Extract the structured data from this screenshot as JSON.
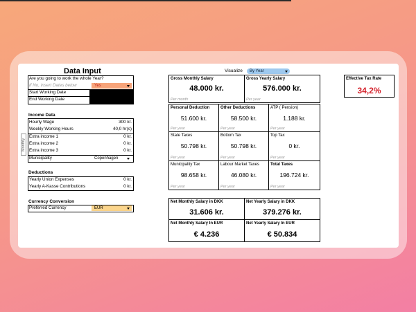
{
  "data_input": {
    "title": "Data Input",
    "question": "Are you going to work the whole Year?",
    "if_no_label": "If No, insert Dates below",
    "if_no_value": "Yes",
    "start_label": "Start Working Date",
    "end_label": "End Working Date"
  },
  "income": {
    "title": "Income Data",
    "side_label": "Monthly",
    "rows": [
      {
        "label": "Hourly Wage",
        "value": "300 kr."
      },
      {
        "label": "Weekly Working Hours",
        "value": "40,0 hr(s)"
      },
      {
        "label": "Extra income 1",
        "value": "0 kr."
      },
      {
        "label": "Extra income 2",
        "value": "0 kr."
      },
      {
        "label": "Extra income 3",
        "value": "0 kr."
      }
    ],
    "municipality_label": "Municipality",
    "municipality_value": "Copenhagen"
  },
  "deductions": {
    "title": "Deductions",
    "rows": [
      {
        "label": "Yearly Union Expenses",
        "value": "0 kr."
      },
      {
        "label": "Yearly A-Kasse Contributions",
        "value": "0 kr."
      }
    ]
  },
  "currency": {
    "title": "Currency Conversion",
    "label": "Preferred Currency",
    "value": "EUR"
  },
  "visualize": {
    "label": "Visualize",
    "value": "By Year"
  },
  "gross": {
    "monthly_label": "Gross Monthly Salary",
    "monthly_value": "48.000 kr.",
    "monthly_note": "Per month",
    "yearly_label": "Gross Yearly Salary",
    "yearly_value": "576.000 kr.",
    "yearly_note": "Per year"
  },
  "deduction_grid": [
    {
      "label": "Personal Deduction",
      "value": "51.600 kr.",
      "note": "Per year",
      "bold": true
    },
    {
      "label": "Other Deductions",
      "value": "58.500 kr.",
      "note": "Per year",
      "bold": true
    },
    {
      "label": "ATP ( Pension)",
      "value": "1.188 kr.",
      "note": "Per year",
      "bold": false
    },
    {
      "label": "State Taxes",
      "value": "50.798 kr.",
      "note": "Per year",
      "bold": false
    },
    {
      "label": "Bottom Tax",
      "value": "50.798 kr.",
      "note": "Per year",
      "bold": false
    },
    {
      "label": "Top Tax",
      "value": "0 kr.",
      "note": "Per year",
      "bold": false
    },
    {
      "label": "Municipality Tax",
      "value": "98.658 kr.",
      "note": "Per year",
      "bold": false
    },
    {
      "label": "Labour Market Taxes",
      "value": "46.080 kr.",
      "note": "Per year",
      "bold": false
    },
    {
      "label": "Total Taxes",
      "value": "196.724 kr.",
      "note": "Per year",
      "bold": true
    }
  ],
  "net": {
    "monthly_dkk_label": "Net Monthly Salary in DKK",
    "monthly_dkk_value": "31.606 kr.",
    "yearly_dkk_label": "Net Yearly Salary in DKK",
    "yearly_dkk_value": "379.276 kr.",
    "monthly_eur_label": "Net Monthly Salary In EUR",
    "monthly_eur_value": "€ 4.236",
    "yearly_eur_label": "Net Yearly Salary In EUR",
    "yearly_eur_value": "€ 50.834"
  },
  "effective_tax": {
    "label": "Effective Tax Rate",
    "value": "34,2%"
  },
  "colors": {
    "accent_red": "#d4202a",
    "dropdown_orange": "#f7a47a",
    "dropdown_yellow": "#fbd58c",
    "dropdown_blue": "#9ec9ef"
  }
}
